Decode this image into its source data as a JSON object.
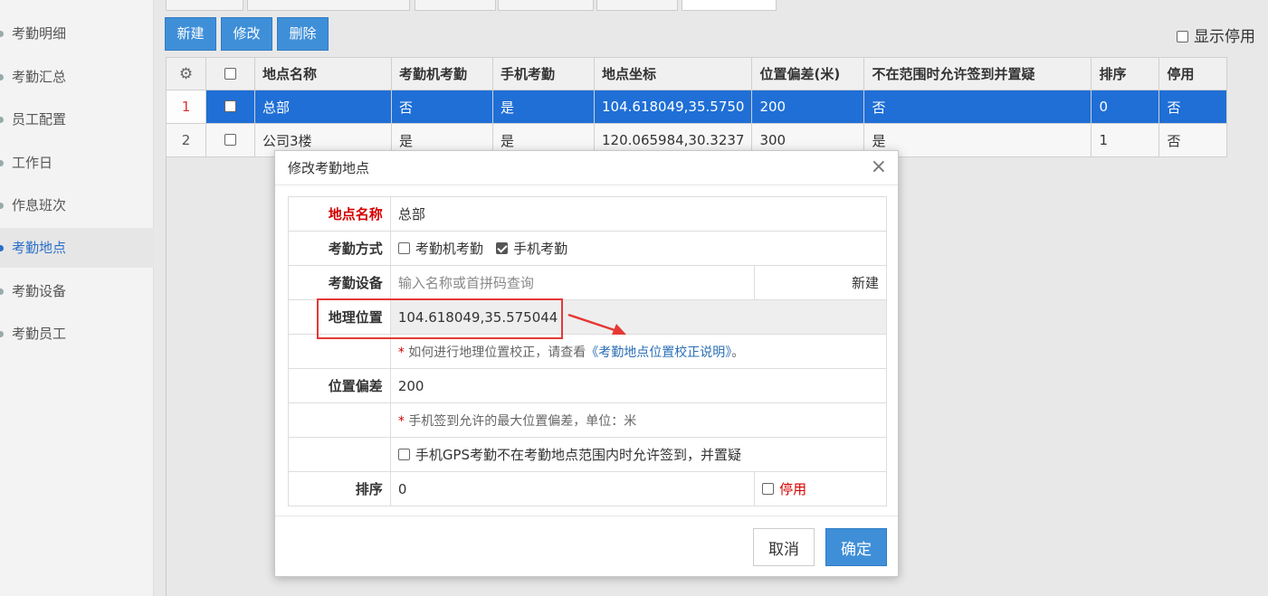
{
  "sidebar": {
    "items": [
      {
        "label": "考勤明细"
      },
      {
        "label": "考勤汇总"
      },
      {
        "label": "员工配置"
      },
      {
        "label": "工作日"
      },
      {
        "label": "作息班次"
      },
      {
        "label": "考勤地点"
      },
      {
        "label": "考勤设备"
      },
      {
        "label": "考勤员工"
      }
    ],
    "active_index": 5
  },
  "toolbar": {
    "new_label": "新建",
    "edit_label": "修改",
    "delete_label": "删除",
    "show_disabled_label": "显示停用"
  },
  "grid": {
    "columns": [
      "地点名称",
      "考勤机考勤",
      "手机考勤",
      "地点坐标",
      "位置偏差(米)",
      "不在范围时允许签到并置疑",
      "排序",
      "停用"
    ],
    "rows": [
      {
        "num": "1",
        "cells": [
          "总部",
          "否",
          "是",
          "104.618049,35.5750",
          "200",
          "否",
          "0",
          "否"
        ]
      },
      {
        "num": "2",
        "cells": [
          "公司3楼",
          "是",
          "是",
          "120.065984,30.3237",
          "300",
          "是",
          "1",
          "否"
        ]
      }
    ]
  },
  "modal": {
    "title": "修改考勤地点",
    "close_glyph": "×",
    "name_label": "地点名称",
    "name_value": "总部",
    "mode_label": "考勤方式",
    "mode_machine": "考勤机考勤",
    "mode_phone": "手机考勤",
    "device_label": "考勤设备",
    "device_placeholder": "输入名称或首拼码查询",
    "device_new": "新建",
    "geo_label": "地理位置",
    "geo_value": "104.618049,35.575044",
    "geo_hint_star": "*",
    "geo_hint_pre": " 如何进行地理位置校正，请查看",
    "geo_hint_link": "《考勤地点位置校正说明》",
    "geo_hint_post": "。",
    "offset_label": "位置偏差",
    "offset_value": "200",
    "offset_hint_star": "*",
    "offset_hint": " 手机签到允许的最大位置偏差，单位：米",
    "gps_check_label": "手机GPS考勤不在考勤地点范围内时允许签到，并置疑",
    "sort_label": "排序",
    "sort_value": "0",
    "disabled_label": "停用",
    "cancel_label": "取消",
    "ok_label": "确定"
  },
  "colors": {
    "primary": "#3f8fd8",
    "selected_row": "#1f6fd6",
    "required": "#d40000",
    "annotation": "#e53935"
  }
}
